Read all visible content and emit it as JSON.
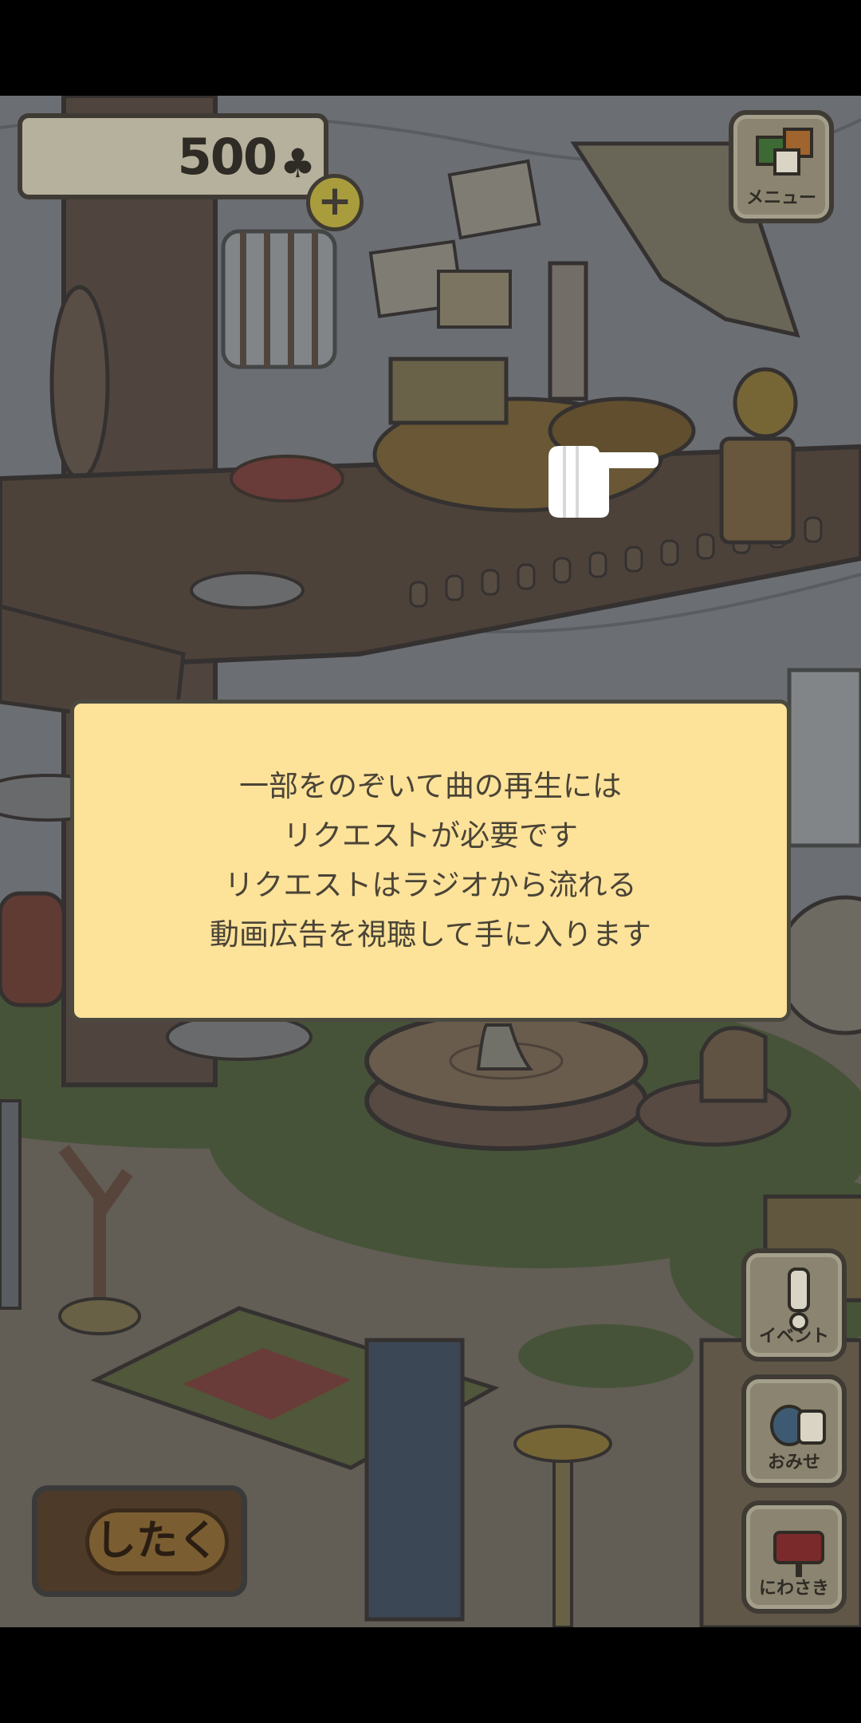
{
  "currency": {
    "amount": "500",
    "symbol": "♣"
  },
  "menu": {
    "label": "メニュー"
  },
  "side_buttons": {
    "event": "イベント",
    "shop": "おみせ",
    "yard": "にわさき"
  },
  "prep_button": {
    "label": "したく"
  },
  "dialog": {
    "lines": [
      "一部をのぞいて曲の再生には",
      "リクエストが必要です",
      "リクエストはラジオから流れる",
      "動画広告を視聴して手に入ります"
    ]
  },
  "colors": {
    "dialog_bg": "#fde29a",
    "dialog_text": "#4a4436",
    "grass": "#4e6332",
    "wood": "#5a4535"
  },
  "icons": [
    "clover-icon",
    "plus-icon",
    "menu-icon",
    "exclamation-icon",
    "bags-icon",
    "mailbox-icon",
    "pointing-hand-icon"
  ]
}
